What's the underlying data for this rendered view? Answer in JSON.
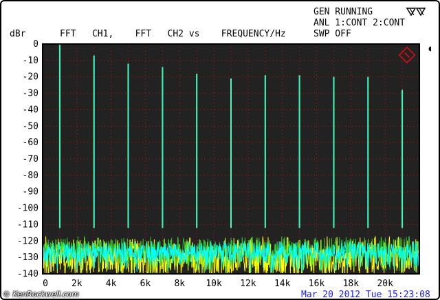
{
  "status": {
    "line1": "GEN RUNNING",
    "line2": "ANL 1:CONT 2:CONT",
    "line3": "SWP OFF"
  },
  "footer": {
    "credit": "© KenRockwell.com",
    "datetime": "Mar 20 2012 Tue 15:23:08"
  },
  "colors": {
    "plot_bg": "#222222",
    "grid": "#cc1111",
    "ch1": "#ffff00",
    "ch2": "#00ffff",
    "noise_green": "#33dd33",
    "logo": "#e01010",
    "date": "#1a1aff"
  },
  "icons": [
    "generator-icon",
    "channel-marker-icon",
    "rs-logo-icon"
  ],
  "chart_data": {
    "type": "line",
    "title": "FFT   CH1,    FFT   CH2 vs    FREQUENCY/Hz",
    "ylabel": "dBr",
    "xlabel": "",
    "xlim": [
      0,
      22000
    ],
    "ylim": [
      -140,
      0
    ],
    "grid": true,
    "x_ticks": [
      0,
      2000,
      4000,
      6000,
      8000,
      10000,
      12000,
      14000,
      16000,
      18000,
      20000
    ],
    "x_tick_labels": [
      "0",
      "2k",
      "4k",
      "6k",
      "8k",
      "10k",
      "12k",
      "14k",
      "16k",
      "18k",
      "20k"
    ],
    "y_ticks": [
      0,
      -10,
      -20,
      -30,
      -40,
      -50,
      -60,
      -70,
      -80,
      -90,
      -100,
      -110,
      -120,
      -130,
      -140
    ],
    "y_tick_labels": [
      "0",
      "-10",
      "-20",
      "-30",
      "-40",
      "-50",
      "-60",
      "-70",
      "-80",
      "-90",
      "-100",
      "-110",
      "-120",
      "-130",
      "-140"
    ],
    "harmonics": {
      "freq_hz": [
        1000,
        3000,
        5000,
        7000,
        9000,
        11000,
        13000,
        15000,
        17000,
        19000,
        21000
      ],
      "level_db": [
        0,
        -7,
        -12,
        -14,
        -18,
        -21,
        -19,
        -19,
        -20,
        -20,
        -28
      ]
    },
    "noise_floor_db": -125
  }
}
